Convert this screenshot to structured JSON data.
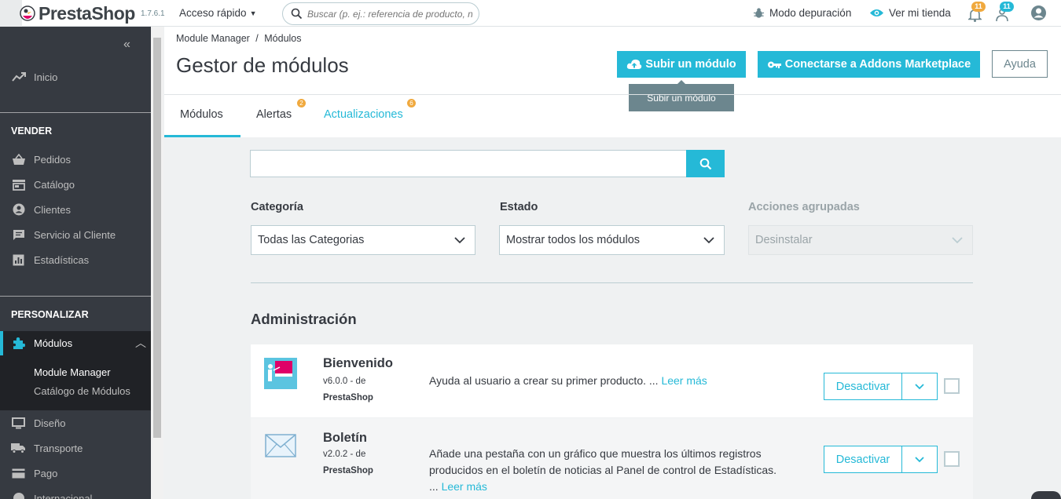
{
  "header": {
    "logo": "PrestaShop",
    "version": "1.7.6.1",
    "quick_access": "Acceso rápido",
    "search_placeholder": "Buscar (p. ej.: referencia de producto, nombre de cliente…)",
    "debug_mode": "Modo depuración",
    "view_store": "Ver mi tienda",
    "notif_count_1": "11",
    "notif_count_2": "11"
  },
  "sidebar": {
    "home": "Inicio",
    "sell_header": "VENDER",
    "sell_items": [
      "Pedidos",
      "Catálogo",
      "Clientes",
      "Servicio al Cliente",
      "Estadísticas"
    ],
    "customize_header": "PERSONALIZAR",
    "active_item": "Módulos",
    "sub_items": [
      "Module Manager",
      "Catálogo de Módulos"
    ],
    "more_items": [
      "Diseño",
      "Transporte",
      "Pago",
      "Internacional"
    ]
  },
  "page": {
    "breadcrumb": [
      "Module Manager",
      "Módulos"
    ],
    "breadcrumb_sep": "/",
    "title": "Gestor de módulos",
    "upload_button": "Subir un módulo",
    "addons_button": "Conectarse a Addons Marketplace",
    "help_button": "Ayuda",
    "tooltip": "Subir un módulo",
    "tabs": [
      {
        "label": "Módulos",
        "badge": ""
      },
      {
        "label": "Alertas",
        "badge": "2"
      },
      {
        "label": "Actualizaciones",
        "badge": "6"
      }
    ]
  },
  "filters": {
    "category_label": "Categoría",
    "category_value": "Todas las Categorias",
    "status_label": "Estado",
    "status_value": "Mostrar todos los módulos",
    "bulk_label": "Acciones agrupadas",
    "bulk_value": "Desinstalar"
  },
  "section": {
    "title": "Administración",
    "modules": [
      {
        "name": "Bienvenido",
        "version": "v6.0.0 - de",
        "author": "PrestaShop",
        "description": "Ayuda al usuario a crear su primer producto. ...",
        "read_more": "Leer más",
        "action": "Desactivar"
      },
      {
        "name": "Boletín",
        "version": "v2.0.2 - de",
        "author": "PrestaShop",
        "description": "Añade una pestaña con un gráfico que muestra los últimos registros producidos en el boletín de noticias al Panel de control de Estadísticas. ...",
        "read_more": "Leer más",
        "action": "Desactivar"
      }
    ]
  },
  "colors": {
    "accent": "#25b9d7",
    "sidebar_bg": "#363a41",
    "badge": "#f0a93e"
  }
}
